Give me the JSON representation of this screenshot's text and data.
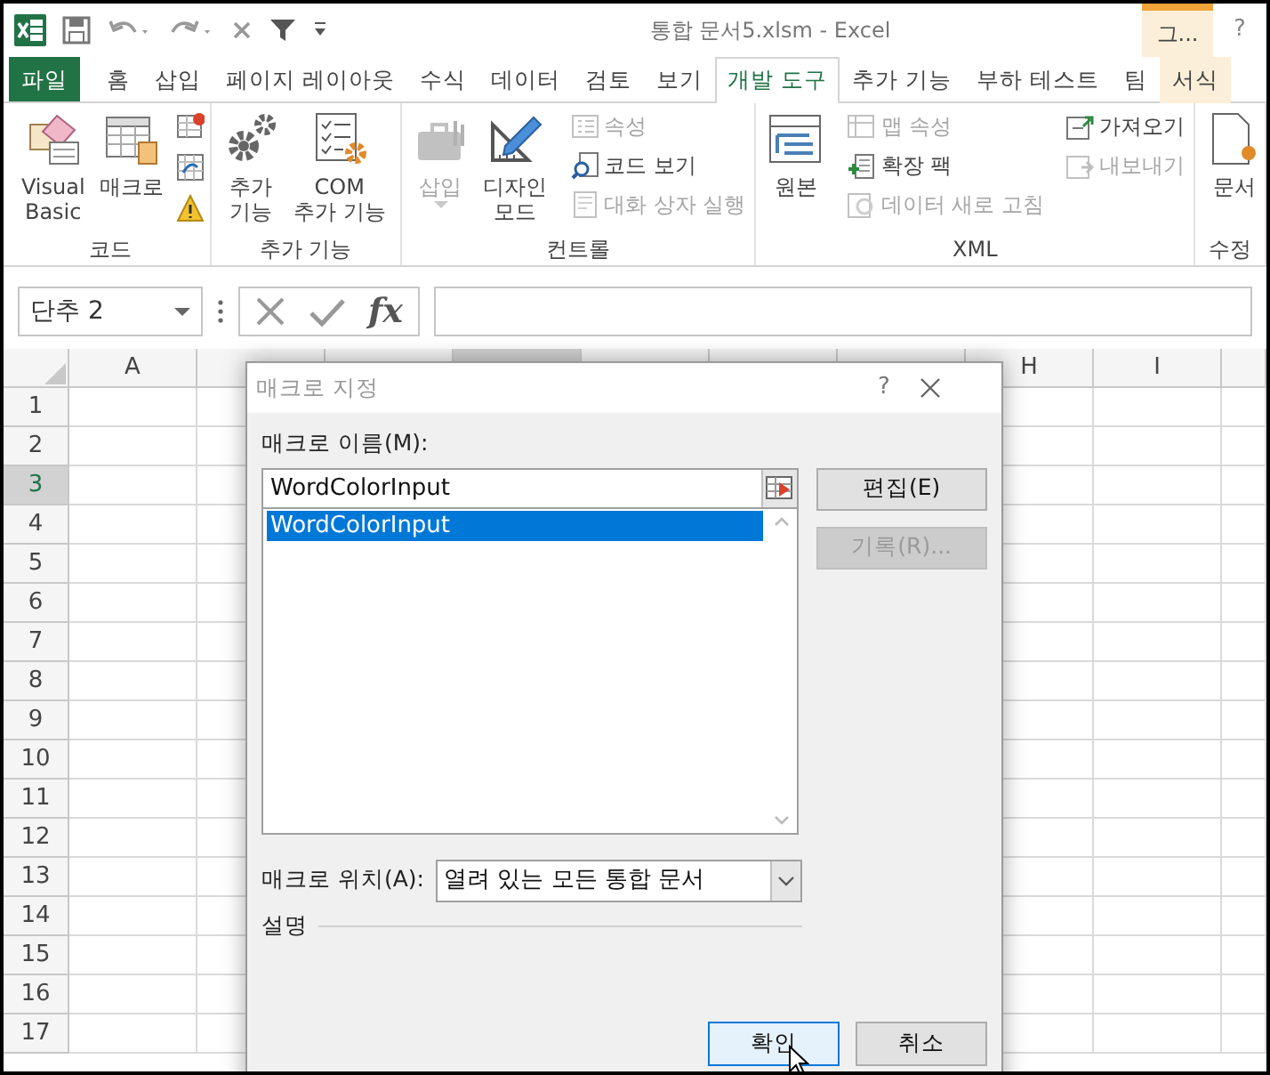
{
  "window": {
    "title": "통합 문서5.xlsm - Excel",
    "context_label": "그...",
    "help": "?"
  },
  "ribbon_tabs": [
    {
      "label": "파일",
      "kind": "file",
      "selected": false
    },
    {
      "label": "홈",
      "kind": "normal",
      "selected": false
    },
    {
      "label": "삽입",
      "kind": "normal",
      "selected": false
    },
    {
      "label": "페이지 레이아웃",
      "kind": "normal",
      "selected": false
    },
    {
      "label": "수식",
      "kind": "normal",
      "selected": false
    },
    {
      "label": "데이터",
      "kind": "normal",
      "selected": false
    },
    {
      "label": "검토",
      "kind": "normal",
      "selected": false
    },
    {
      "label": "보기",
      "kind": "normal",
      "selected": false
    },
    {
      "label": "개발 도구",
      "kind": "normal",
      "selected": true
    },
    {
      "label": "추가 기능",
      "kind": "normal",
      "selected": false
    },
    {
      "label": "부하 테스트",
      "kind": "normal",
      "selected": false
    },
    {
      "label": "팀",
      "kind": "normal",
      "selected": false
    },
    {
      "label": "서식",
      "kind": "context",
      "selected": false
    }
  ],
  "ribbon_groups": [
    {
      "label": "코드",
      "kind": "code",
      "large": [
        {
          "label": "Visual\nBasic",
          "disabled": false
        },
        {
          "label": "매크로",
          "disabled": false
        }
      ]
    },
    {
      "label": "추가 기능",
      "kind": "addins",
      "large": [
        {
          "label": "추가\n기능",
          "disabled": false
        },
        {
          "label": "COM\n추가 기능",
          "disabled": false
        }
      ]
    },
    {
      "label": "컨트롤",
      "kind": "controls",
      "large": [
        {
          "label": "삽입",
          "disabled": true,
          "menu": true
        },
        {
          "label": "디자인\n모드",
          "disabled": false
        }
      ],
      "small": [
        {
          "label": "속성",
          "disabled": true
        },
        {
          "label": "코드 보기",
          "disabled": false
        },
        {
          "label": "대화 상자 실행",
          "disabled": true
        }
      ]
    },
    {
      "label": "XML",
      "kind": "xml",
      "large": [
        {
          "label": "원본",
          "disabled": false
        }
      ],
      "small": [
        {
          "label": "맵 속성",
          "disabled": true
        },
        {
          "label": "확장 팩",
          "disabled": false
        },
        {
          "label": "데이터 새로 고침",
          "disabled": true
        },
        {
          "label": "가져오기",
          "disabled": false
        },
        {
          "label": "내보내기",
          "disabled": true
        }
      ]
    },
    {
      "label": "수정",
      "kind": "modify",
      "large": [
        {
          "label": "문서",
          "disabled": false
        }
      ]
    }
  ],
  "formula_bar": {
    "name_box": "단추 2",
    "function_button": "fx"
  },
  "sheet": {
    "columns": [
      {
        "label": "A",
        "selected": false
      },
      {
        "selected": false
      },
      {
        "selected": false
      },
      {
        "selected": true
      },
      {
        "selected": false
      },
      {
        "selected": false
      },
      {
        "selected": false
      },
      {
        "label": "H",
        "selected": false
      },
      {
        "label": "I",
        "selected": false
      },
      {
        "selected": false
      }
    ],
    "rows": [
      {
        "label": "1",
        "selected": false
      },
      {
        "label": "2",
        "selected": false
      },
      {
        "label": "3",
        "selected": true
      },
      {
        "label": "4",
        "selected": false
      },
      {
        "label": "5",
        "selected": false
      },
      {
        "label": "6",
        "selected": false
      },
      {
        "label": "7",
        "selected": false
      },
      {
        "label": "8",
        "selected": false
      },
      {
        "label": "9",
        "selected": false
      },
      {
        "label": "10",
        "selected": false
      },
      {
        "label": "11",
        "selected": false
      },
      {
        "label": "12",
        "selected": false
      },
      {
        "label": "13",
        "selected": false
      },
      {
        "label": "14",
        "selected": false
      },
      {
        "label": "15",
        "selected": false
      },
      {
        "label": "16",
        "selected": false
      },
      {
        "label": "17",
        "selected": false
      }
    ]
  },
  "dialog": {
    "title": "매크로 지정",
    "help": "?",
    "name_label": "매크로 이름(M):",
    "name_value": "WordColorInput",
    "macros": [
      {
        "label": "WordColorInput",
        "selected": true
      }
    ],
    "side_buttons": [
      {
        "label": "편집(E)",
        "disabled": false
      },
      {
        "label": "기록(R)...",
        "disabled": true
      }
    ],
    "location_label": "매크로 위치(A):",
    "location_value": "열려 있는 모든 통합 문서",
    "description_label": "설명",
    "buttons": [
      {
        "label": "확인",
        "focused": true
      },
      {
        "label": "취소",
        "focused": false
      }
    ]
  }
}
